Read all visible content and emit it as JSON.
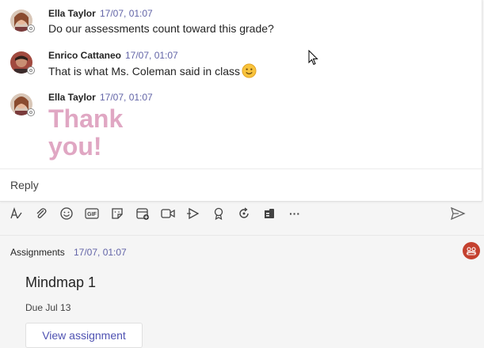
{
  "messages": [
    {
      "author": "Ella Taylor",
      "time": "17/07, 01:07",
      "text": "Do our assessments count toward this grade?"
    },
    {
      "author": "Enrico Cattaneo",
      "time": "17/07, 01:07",
      "text": "That is what Ms. Coleman said in class",
      "emoji": "slightly-smiling-face"
    },
    {
      "author": "Ella Taylor",
      "time": "17/07, 01:07",
      "big_text_line1": "Thank",
      "big_text_line2": "you!"
    }
  ],
  "reply": {
    "label": "Reply"
  },
  "toolbar": {
    "icons": [
      "format-icon",
      "attach-icon",
      "emoji-icon",
      "gif-icon",
      "sticker-icon",
      "schedule-meeting-icon",
      "video-icon",
      "stream-icon",
      "praise-icon",
      "loop-icon",
      "forms-icon",
      "more-options-icon",
      "send-icon"
    ],
    "gif_label": "GIF",
    "more_label": "···"
  },
  "assignment": {
    "header": "Assignments",
    "time": "17/07, 01:07",
    "title": "Mindmap 1",
    "due": "Due Jul 13",
    "button": "View assignment"
  },
  "colors": {
    "accent": "#6264a7",
    "big_text": "#e0a7c3",
    "app_badge": "#c4412f",
    "emoji": "#f8c33c"
  }
}
